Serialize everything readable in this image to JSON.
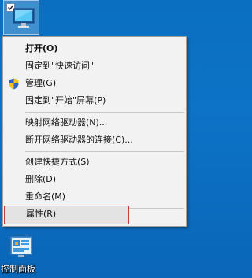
{
  "desktop": {
    "this_pc_icon": "computer-icon",
    "control_panel": {
      "icon": "control-panel-icon",
      "label": "控制面板"
    }
  },
  "context_menu": {
    "items": [
      {
        "label": "打开(O)",
        "bold": true
      },
      {
        "label": "固定到\"快速访问\""
      },
      {
        "label": "管理(G)",
        "icon": "shield-icon"
      },
      {
        "label": "固定到\"开始\"屏幕(P)"
      },
      {
        "label": "映射网络驱动器(N)..."
      },
      {
        "label": "断开网络驱动器的连接(C)..."
      },
      {
        "label": "创建快捷方式(S)"
      },
      {
        "label": "删除(D)"
      },
      {
        "label": "重命名(M)"
      },
      {
        "label": "属性(R)",
        "highlighted": true
      }
    ]
  },
  "colors": {
    "desktop_background": "#0a6fc0",
    "menu_background": "#f2f2f2",
    "highlight_border": "#c43c3c"
  }
}
